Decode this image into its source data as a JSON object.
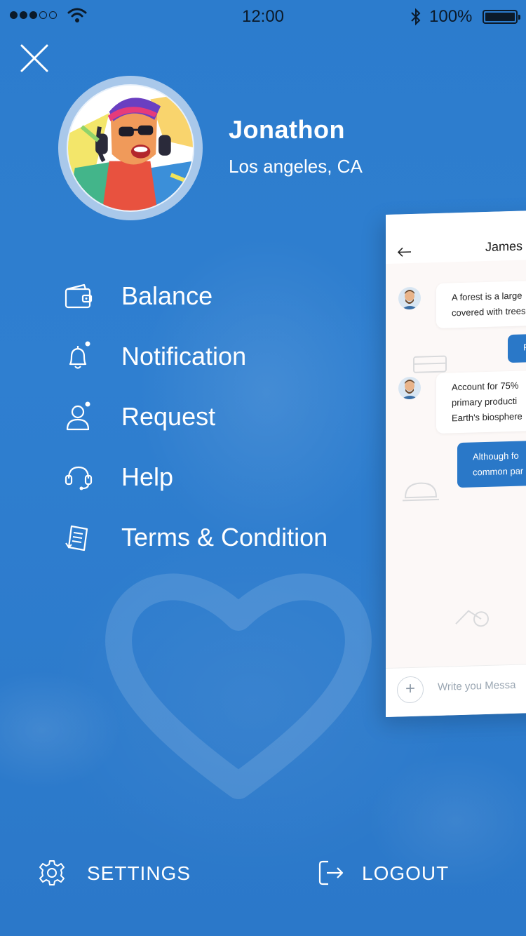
{
  "status_bar": {
    "time": "12:00",
    "battery_percent": "100%",
    "signal_bars_filled": 3,
    "signal_bars_total": 5
  },
  "profile": {
    "name": "Jonathon",
    "location": "Los angeles, CA"
  },
  "menu": {
    "items": [
      {
        "label": "Balance",
        "icon": "wallet-icon"
      },
      {
        "label": "Notification",
        "icon": "bell-icon"
      },
      {
        "label": "Request",
        "icon": "user-request-icon"
      },
      {
        "label": "Help",
        "icon": "headset-icon"
      },
      {
        "label": "Terms & Condition",
        "icon": "document-icon"
      }
    ]
  },
  "bottom": {
    "settings_label": "SETTINGS",
    "logout_label": "LOGOUT"
  },
  "chat_preview": {
    "title": "James",
    "messages": [
      {
        "direction": "in",
        "lines": [
          "A forest is a large",
          "covered with trees"
        ]
      },
      {
        "direction": "out",
        "lines": [
          "F"
        ]
      },
      {
        "direction": "in",
        "lines": [
          "Account for 75%",
          "primary producti",
          "Earth's biosphere"
        ]
      },
      {
        "direction": "out",
        "lines": [
          "Although fo",
          "common par"
        ]
      }
    ],
    "input_placeholder": "Write you Messa"
  },
  "colors": {
    "background": "#2f7fd0",
    "accent": "#2a78c8",
    "text_light": "#ffffff"
  }
}
